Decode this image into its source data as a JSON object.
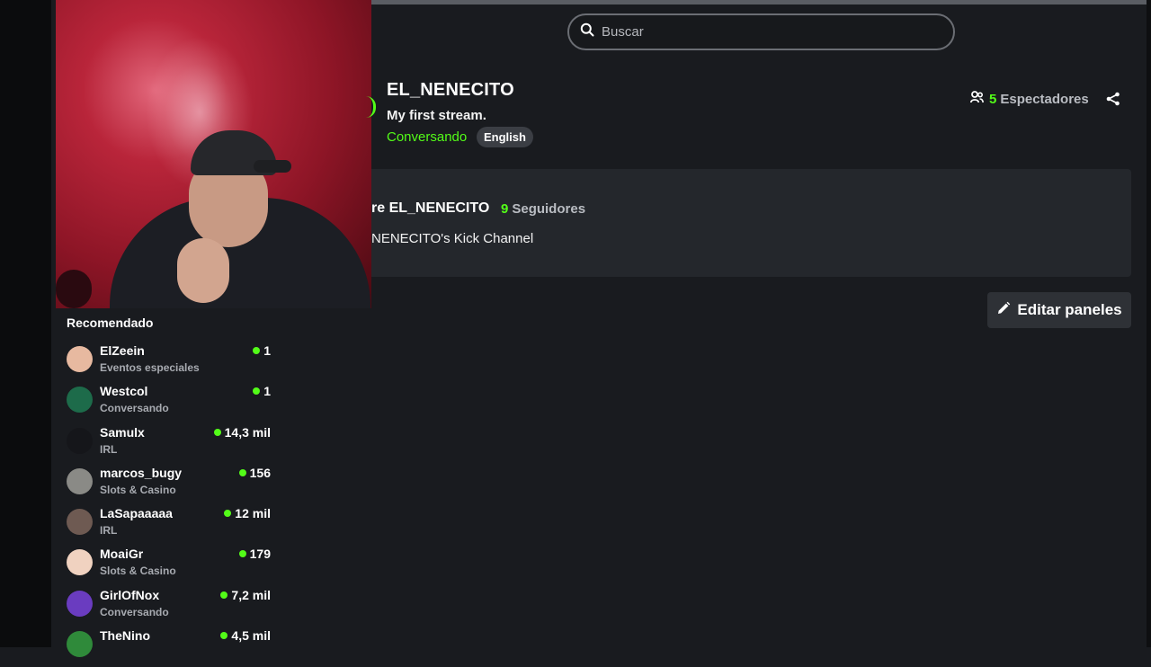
{
  "search": {
    "placeholder": "Buscar"
  },
  "stream": {
    "streamer": "EL_NENECITO",
    "title": "My first stream.",
    "category": "Conversando",
    "language": "English",
    "viewers_count": "5",
    "viewers_label": "Espectadores"
  },
  "about": {
    "title": "re EL_NENECITO",
    "followers_count": "9",
    "followers_label": "Seguidores",
    "description": "NENECITO's Kick Channel"
  },
  "panels": {
    "edit_label": "Editar paneles"
  },
  "recommended": {
    "title": "Recomendado",
    "items": [
      {
        "name": "ElZeein",
        "category": "Eventos especiales",
        "viewers": "1",
        "avatar_color": "#e7b9a0"
      },
      {
        "name": "Westcol",
        "category": "Conversando",
        "viewers": "1",
        "avatar_color": "#1d6b4a"
      },
      {
        "name": "Samulx",
        "category": "IRL",
        "viewers": "14,3 mil",
        "avatar_color": "#15161a"
      },
      {
        "name": "marcos_bugy",
        "category": "Slots & Casino",
        "viewers": "156",
        "avatar_color": "#8a8a86"
      },
      {
        "name": "LaSapaaaaa",
        "category": "IRL",
        "viewers": "12 mil",
        "avatar_color": "#6e5a52"
      },
      {
        "name": "MoaiGr",
        "category": "Slots & Casino",
        "viewers": "179",
        "avatar_color": "#f0d2c0"
      },
      {
        "name": "GirlOfNox",
        "category": "Conversando",
        "viewers": "7,2 mil",
        "avatar_color": "#6a3cc0"
      },
      {
        "name": "TheNino",
        "category": "",
        "viewers": "4,5 mil",
        "avatar_color": "#2f8a3a"
      }
    ]
  },
  "colors": {
    "accent": "#53fc18",
    "background": "#191b1f",
    "panel": "#24272c"
  }
}
